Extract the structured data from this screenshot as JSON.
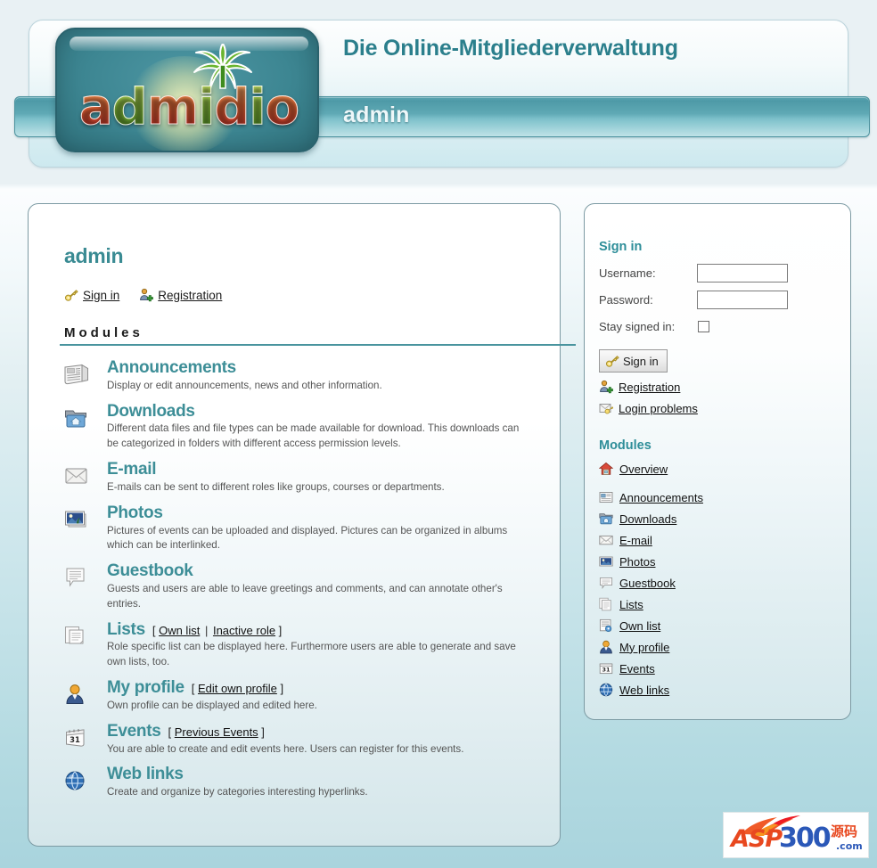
{
  "header": {
    "slogan": "Die Online-Mitgliederverwaltung",
    "org_name": "admin",
    "logo_text_parts": [
      "a",
      "d",
      "m",
      "i",
      "d",
      "i",
      "o"
    ],
    "logo_alt": "admidio",
    "accent_teal": "#3d8e97",
    "nav_bar_color": "#5fa9b5",
    "slogan_color": "#2b7f8c"
  },
  "main": {
    "page_title": "admin",
    "top_links": [
      {
        "label": "Sign in",
        "icon": "key-icon"
      },
      {
        "label": "Registration",
        "icon": "user-add-icon"
      }
    ],
    "modules_heading": "Modules",
    "modules": [
      {
        "icon": "announcements-icon",
        "title": "Announcements",
        "extras": [],
        "description": "Display or edit announcements, news and other information."
      },
      {
        "icon": "downloads-icon",
        "title": "Downloads",
        "extras": [],
        "description": "Different data files and file types can be made available for download. This downloads can be categorized in folders with different access permission levels."
      },
      {
        "icon": "email-icon",
        "title": "E-mail",
        "extras": [],
        "description": "E-mails can be sent to different roles like groups, courses or departments."
      },
      {
        "icon": "photos-icon",
        "title": "Photos",
        "extras": [],
        "description": "Pictures of events can be uploaded and displayed. Pictures can be organized in albums which can be interlinked."
      },
      {
        "icon": "guestbook-icon",
        "title": "Guestbook",
        "extras": [],
        "description": "Guests and users are able to leave greetings and comments, and can annotate other's entries."
      },
      {
        "icon": "lists-icon",
        "title": "Lists",
        "extras": [
          "Own list",
          "Inactive role"
        ],
        "description": "Role specific list can be displayed here. Furthermore users are able to generate and save own lists, too."
      },
      {
        "icon": "profile-icon",
        "title": "My profile",
        "extras": [
          "Edit own profile"
        ],
        "description": "Own profile can be displayed and edited here."
      },
      {
        "icon": "events-icon",
        "title": "Events",
        "extras": [
          "Previous Events"
        ],
        "description": "You are able to create and edit events here. Users can register for this events."
      },
      {
        "icon": "weblinks-icon",
        "title": "Web links",
        "extras": [],
        "description": "Create and organize by categories interesting hyperlinks."
      }
    ]
  },
  "sidebar": {
    "signin_heading": "Sign in",
    "username_label": "Username:",
    "username_value": "",
    "password_label": "Password:",
    "password_value": "",
    "stay_signed_label": "Stay signed in:",
    "stay_signed_checked": false,
    "signin_button": "Sign in",
    "links": [
      {
        "label": "Registration",
        "icon": "user-add-icon"
      },
      {
        "label": "Login problems",
        "icon": "mail-key-icon"
      }
    ],
    "modules_heading": "Modules",
    "modules": [
      {
        "label": "Overview",
        "icon": "home-icon"
      },
      {
        "label": "Announcements",
        "icon": "announcements-icon"
      },
      {
        "label": "Downloads",
        "icon": "downloads-icon"
      },
      {
        "label": "E-mail",
        "icon": "email-icon"
      },
      {
        "label": "Photos",
        "icon": "photos-icon"
      },
      {
        "label": "Guestbook",
        "icon": "guestbook-icon"
      },
      {
        "label": "Lists",
        "icon": "lists-icon"
      },
      {
        "label": "Own list",
        "icon": "own-list-icon"
      },
      {
        "label": "My profile",
        "icon": "profile-icon"
      },
      {
        "label": "Events",
        "icon": "events-icon"
      },
      {
        "label": "Web links",
        "icon": "weblinks-icon"
      }
    ]
  },
  "watermark": {
    "asp": "ASP",
    "num": "300",
    "cn": "源码",
    "com": ".com"
  }
}
